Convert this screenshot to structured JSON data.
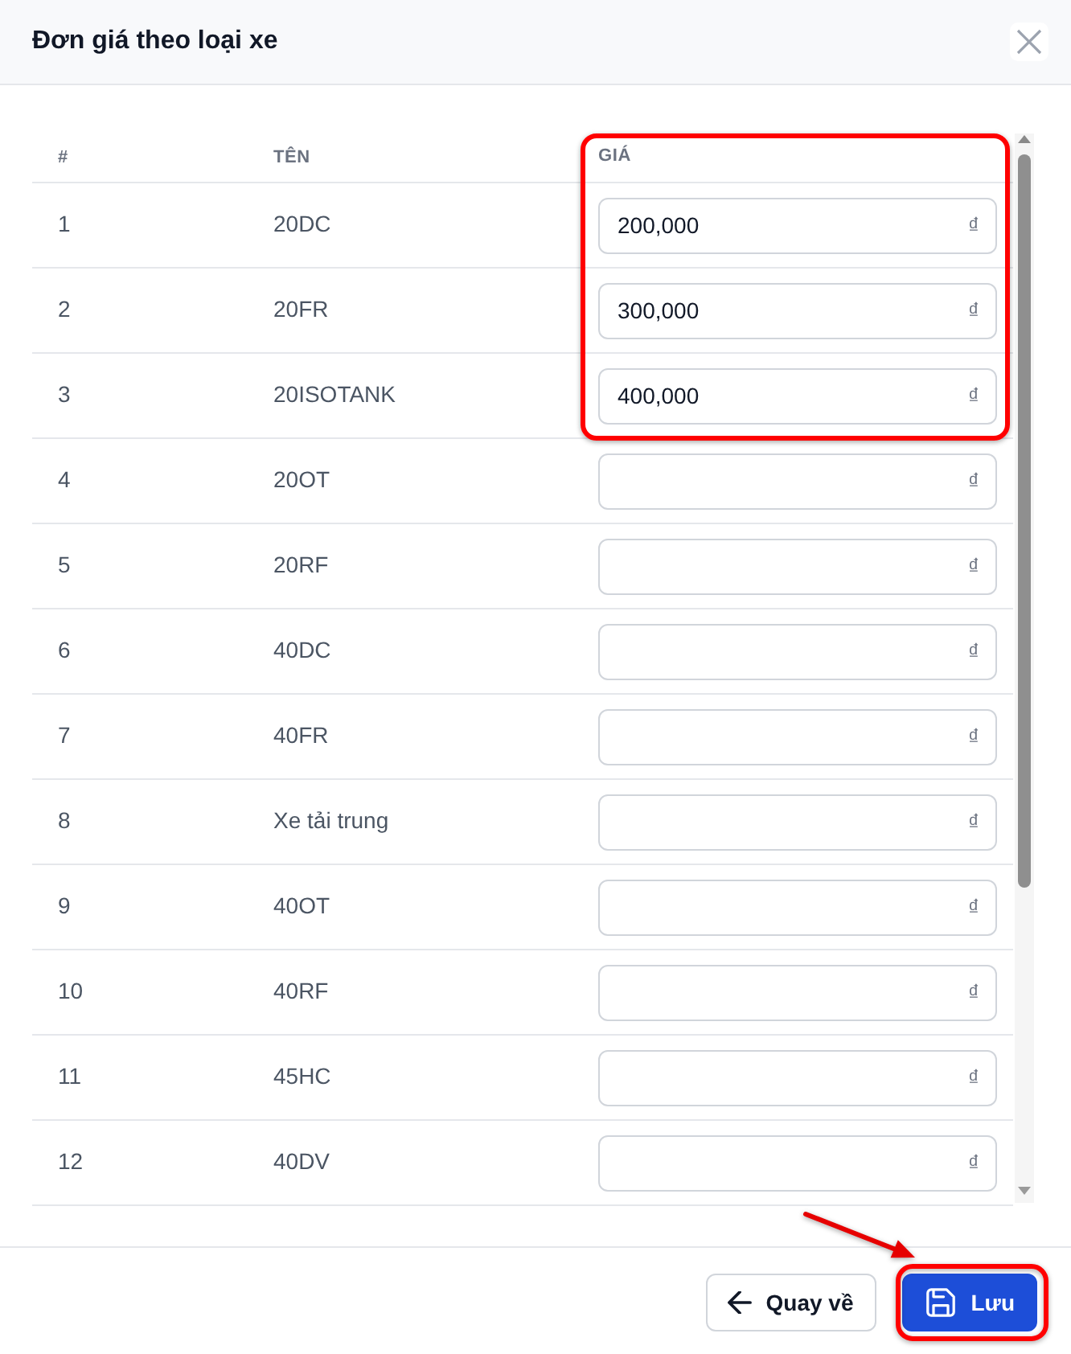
{
  "window": {
    "title": "Đơn giá theo loại xe"
  },
  "table": {
    "columns": [
      {
        "label": "#",
        "highlighted": false
      },
      {
        "label": "TÊN",
        "highlighted": false
      },
      {
        "label": "GIÁ",
        "highlighted": true
      }
    ],
    "rows": [
      {
        "number": "1",
        "name": "20DC",
        "price": "200,000",
        "currency": "₫",
        "highlighted": true
      },
      {
        "number": "2",
        "name": "20FR",
        "price": "300,000",
        "currency": "₫",
        "highlighted": true
      },
      {
        "number": "3",
        "name": "20ISOTANK",
        "price": "400,000",
        "currency": "₫",
        "highlighted": true
      },
      {
        "number": "4",
        "name": "20OT",
        "currency": "₫",
        "highlighted": false
      },
      {
        "number": "5",
        "name": "20RF",
        "currency": "₫",
        "highlighted": false
      },
      {
        "number": "6",
        "name": "40DC",
        "currency": "₫",
        "highlighted": false
      },
      {
        "number": "7",
        "name": "40FR",
        "currency": "₫",
        "highlighted": false
      },
      {
        "number": "8",
        "name": "Xe tải trung",
        "currency": "₫",
        "highlighted": false
      },
      {
        "number": "9",
        "name": "40OT",
        "currency": "₫",
        "highlighted": false
      },
      {
        "number": "10",
        "name": "40RF",
        "currency": "₫",
        "highlighted": false
      },
      {
        "number": "11",
        "name": "45HC",
        "currency": "₫",
        "highlighted": false
      },
      {
        "number": "12",
        "name": "40DV",
        "currency": "₫",
        "highlighted": false
      }
    ]
  },
  "footer": {
    "buttons": [
      {
        "kind": "back",
        "label": "Quay về",
        "highlighted": false,
        "arrow": false
      },
      {
        "kind": "save",
        "label": "Lưu",
        "highlighted": true,
        "arrow": true
      }
    ]
  }
}
